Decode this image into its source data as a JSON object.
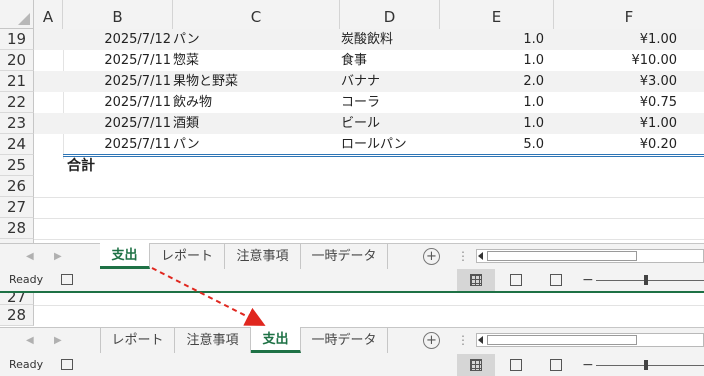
{
  "columns": [
    "A",
    "B",
    "C",
    "D",
    "E",
    "F"
  ],
  "rows": [
    {
      "num": "19",
      "date": "2025/7/12",
      "category": "パン",
      "item": "炭酸飲料",
      "qty": "1.0",
      "price": "¥1.00"
    },
    {
      "num": "20",
      "date": "2025/7/11",
      "category": "惣菜",
      "item": "食事",
      "qty": "1.0",
      "price": "¥10.00"
    },
    {
      "num": "21",
      "date": "2025/7/11",
      "category": "果物と野菜",
      "item": "バナナ",
      "qty": "2.0",
      "price": "¥3.00"
    },
    {
      "num": "22",
      "date": "2025/7/11",
      "category": "飲み物",
      "item": "コーラ",
      "qty": "1.0",
      "price": "¥0.75"
    },
    {
      "num": "23",
      "date": "2025/7/11",
      "category": "酒類",
      "item": "ビール",
      "qty": "1.0",
      "price": "¥1.00"
    },
    {
      "num": "24",
      "date": "2025/7/11",
      "category": "パン",
      "item": "ロールパン",
      "qty": "5.0",
      "price": "¥0.20"
    }
  ],
  "total_row": {
    "num": "25",
    "label": "合計"
  },
  "empty_rows": [
    "26",
    "27",
    "28"
  ],
  "tabs_before": [
    "支出",
    "レポート",
    "注意事項",
    "一時データ"
  ],
  "tabs_after": [
    "レポート",
    "注意事項",
    "支出",
    "一時データ"
  ],
  "active_tab": "支出",
  "add_sheet_symbol": "+",
  "more_symbol": "⋮",
  "status": {
    "ready": "Ready",
    "zoom_minus": "−",
    "zoom_plus": "+"
  },
  "after_rows": [
    "27",
    "28"
  ],
  "colors": {
    "accent": "#1e7145",
    "arrow": "#e0271f",
    "band": "#f2f2f2",
    "table_border": "#2e75b6"
  }
}
